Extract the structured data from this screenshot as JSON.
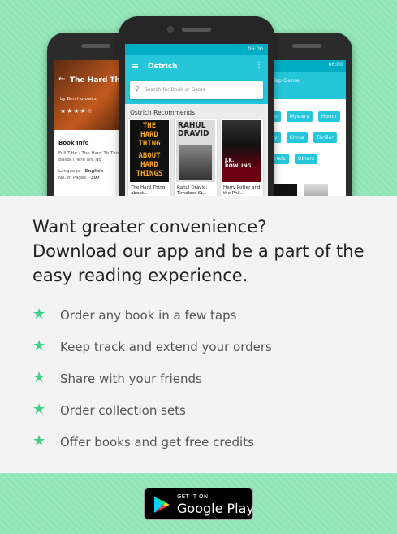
{
  "left_phone": {
    "book_title": "The Hard Thin",
    "author": "by Ben Horowitz",
    "stars": "★★★★☆",
    "info_heading": "Book Info",
    "full_title_label": "Full Title",
    "full_title_value": "The Hard Th Thing: Buildi There are No",
    "language_label": "Language",
    "language_value": "English",
    "pages_label": "No. of Pages",
    "pages_value": "307"
  },
  "center_phone": {
    "time": "06:00",
    "app_title": "Ostrich",
    "search_placeholder": "Search for Book or Genre",
    "section_title": "Ostrich Recommends",
    "books": [
      {
        "cover_lines": [
          "THE",
          "HARD",
          "THING",
          "ABOUT",
          "HARD",
          "THINGS"
        ],
        "caption": "The Hard Thing about..."
      },
      {
        "cover_lines": [
          "RAHUL",
          "DRAVID"
        ],
        "caption": "Rahul Dravid: Timeless St..."
      },
      {
        "cover_lines": [
          "J.K. ROWLING"
        ],
        "caption": "Harry Potter and the Phil..."
      }
    ]
  },
  "right_phone": {
    "time": "06:00",
    "header_text": "Tap Genre",
    "genres": [
      "n",
      "Mystery",
      "Horror",
      "y",
      "Crime",
      "Thriller",
      "Help",
      "Others"
    ]
  },
  "promo": {
    "headline_1": "Want greater convenience?",
    "headline_2": "Download our app and be a part of the",
    "headline_3": "easy reading experience.",
    "features": [
      "Order any book in a few taps",
      "Keep track and extend your orders",
      "Share with your friends",
      "Order collection sets",
      "Offer books and get free credits"
    ]
  },
  "badge": {
    "small": "GET IT ON",
    "big": "Google Play"
  },
  "colors": {
    "background": "#8fe4b6",
    "accent": "#26c6da",
    "star": "#3ed08b"
  },
  "icons": [
    "star-icon",
    "menu-icon",
    "search-icon",
    "back-arrow-icon",
    "play-store-icon"
  ]
}
